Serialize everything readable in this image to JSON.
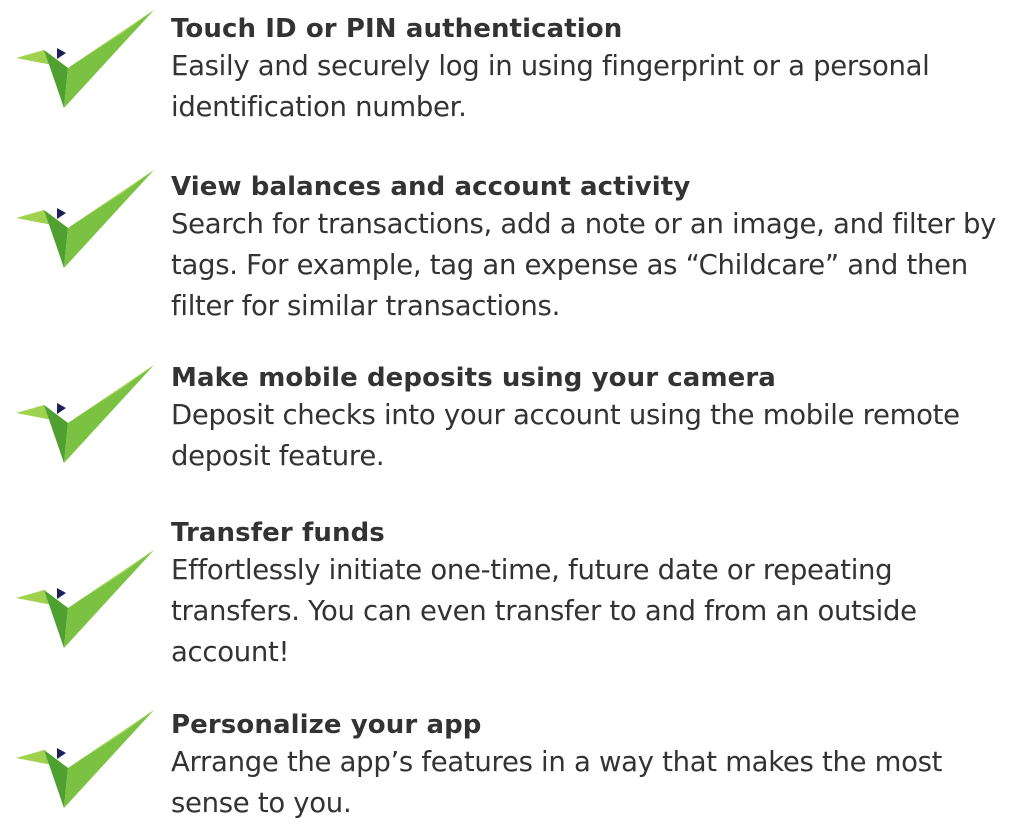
{
  "icon": {
    "name": "checkmark-icon",
    "color_light": "#9ed24f",
    "color_dark": "#4fa030",
    "marker_color": "#1c1f5a"
  },
  "features": [
    {
      "title": "Touch ID or PIN authentication",
      "description": "Easily and securely log in using fingerprint or a personal identification number."
    },
    {
      "title": "View balances and account activity",
      "description": "Search for transactions, add a note or an image, and filter by tags.  For example, tag an expense as “Childcare” and then filter for similar transactions."
    },
    {
      "title": "Make mobile deposits using your camera",
      "description": "Deposit checks into your account using the mobile remote deposit feature."
    },
    {
      "title": "Transfer funds",
      "description": "Effortlessly initiate one-time, future date or repeating transfers.  You can even transfer to and from an outside account!"
    },
    {
      "title": "Personalize your app",
      "description": "Arrange the app’s features in a way that makes the most sense to you."
    }
  ]
}
